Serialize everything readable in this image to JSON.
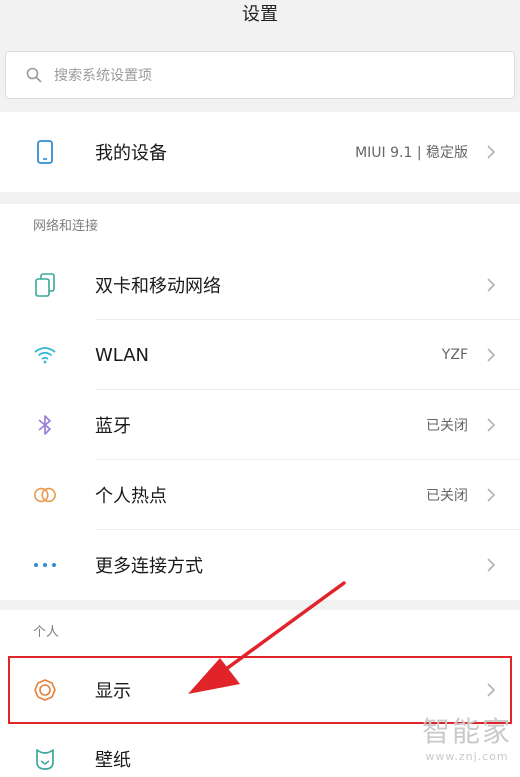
{
  "header": {
    "title": "设置"
  },
  "search": {
    "placeholder": "搜索系统设置项"
  },
  "device": {
    "label": "我的设备",
    "value": "MIUI 9.1 | 稳定版"
  },
  "network": {
    "title": "网络和连接",
    "items": [
      {
        "label": "双卡和移动网络",
        "value": "",
        "icon": "sim-card-icon",
        "color": "#3aa89a"
      },
      {
        "label": "WLAN",
        "value": "YZF",
        "icon": "wifi-icon",
        "color": "#2fb6d9"
      },
      {
        "label": "蓝牙",
        "value": "已关闭",
        "icon": "bluetooth-icon",
        "color": "#9b7fd6"
      },
      {
        "label": "个人热点",
        "value": "已关闭",
        "icon": "hotspot-icon",
        "color": "#e89a4a"
      },
      {
        "label": "更多连接方式",
        "value": "",
        "icon": "more-dots-icon",
        "color": "#2f8fd6"
      }
    ]
  },
  "personal": {
    "title": "个人",
    "items": [
      {
        "label": "显示",
        "value": "",
        "icon": "brightness-icon",
        "color": "#e8803a"
      },
      {
        "label": "壁纸",
        "value": "",
        "icon": "wallpaper-icon",
        "color": "#3aa89a"
      }
    ]
  },
  "annotation": {
    "highlight_color": "#e0242a"
  },
  "watermark": {
    "line1": "智能家",
    "line2": "www.znj.com"
  }
}
